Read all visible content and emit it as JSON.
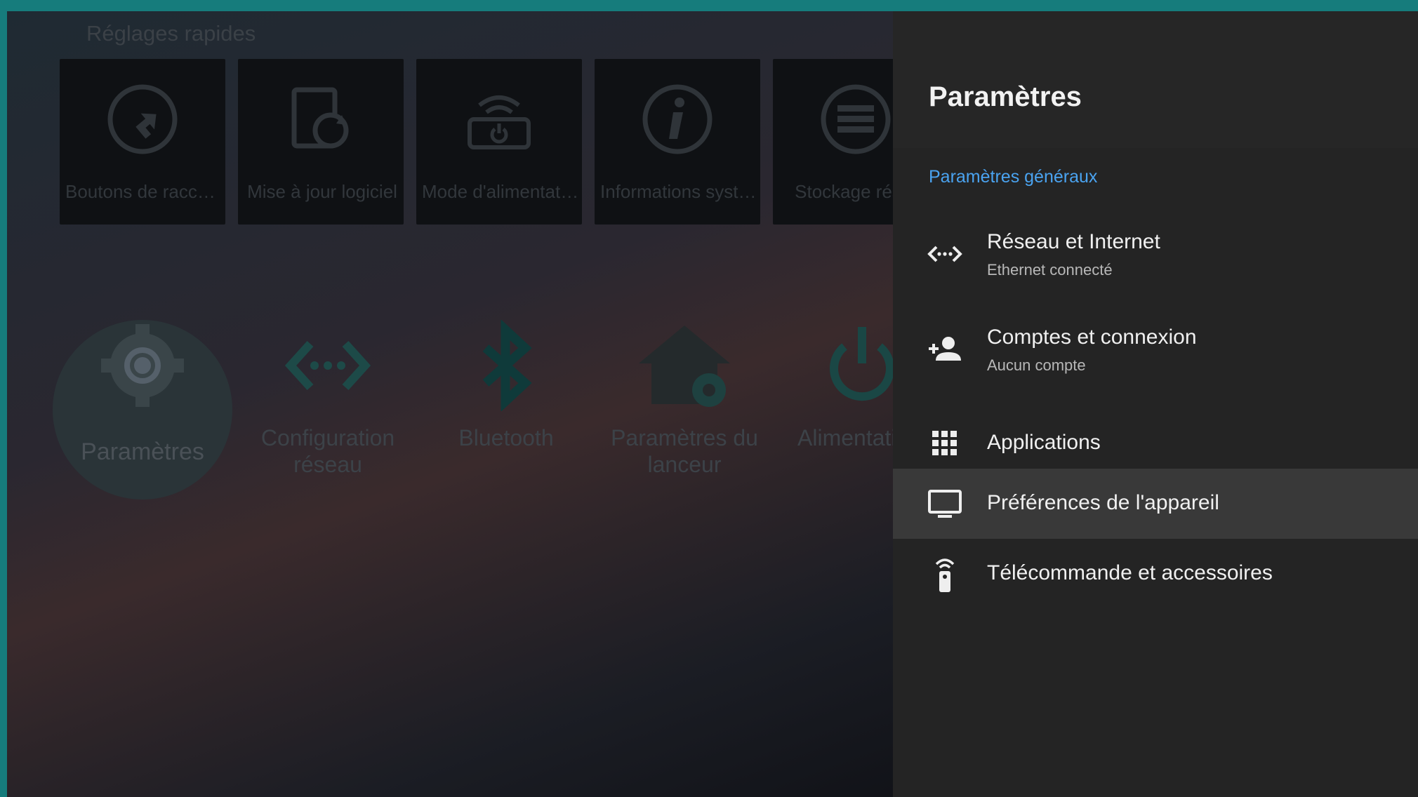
{
  "quick_settings": {
    "title": "Réglages rapides",
    "tiles": [
      {
        "label": "Boutons de raccou...",
        "icon": "shortcut-icon"
      },
      {
        "label": "Mise à jour logiciel",
        "icon": "update-icon"
      },
      {
        "label": "Mode d'alimentation",
        "icon": "power-mode-icon"
      },
      {
        "label": "Informations systè...",
        "icon": "info-icon"
      },
      {
        "label": "Stockage rés",
        "icon": "storage-icon"
      }
    ]
  },
  "apps": [
    {
      "label": "Paramètres",
      "icon": "gear-icon"
    },
    {
      "label": "Configuration réseau",
      "icon": "network-icon"
    },
    {
      "label": "Bluetooth",
      "icon": "bluetooth-icon"
    },
    {
      "label": "Paramètres du lanceur",
      "icon": "launcher-settings-icon"
    },
    {
      "label": "Alimentati",
      "icon": "power-icon"
    }
  ],
  "panel": {
    "title": "Paramètres",
    "section": "Paramètres généraux",
    "items": [
      {
        "title": "Réseau et Internet",
        "subtitle": "Ethernet connecté",
        "icon": "network-icon"
      },
      {
        "title": "Comptes et connexion",
        "subtitle": "Aucun compte",
        "icon": "add-person-icon"
      },
      {
        "title": "Applications",
        "icon": "apps-grid-icon"
      },
      {
        "title": "Préférences de l'appareil",
        "icon": "tv-icon"
      },
      {
        "title": "Télécommande et accessoires",
        "icon": "remote-icon"
      }
    ]
  },
  "colors": {
    "accent": "#4aa3f0",
    "frame": "#167c7c",
    "panel_bg": "#242424",
    "selected_row": "#393939"
  }
}
